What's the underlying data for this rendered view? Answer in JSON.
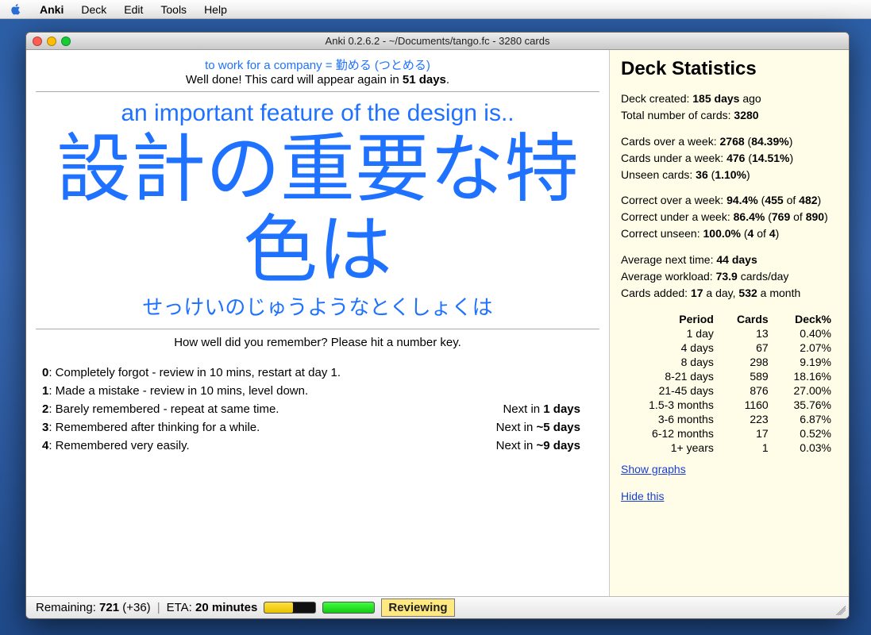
{
  "menubar": {
    "app": "Anki",
    "items": [
      "Deck",
      "Edit",
      "Tools",
      "Help"
    ]
  },
  "window": {
    "title": "Anki 0.2.6.2 - ~/Documents/tango.fc - 3280 cards"
  },
  "feedback": {
    "prev": "to work for a company = 勤める (つとめる)",
    "msg_prefix": "Well done! This card will appear again in ",
    "msg_days": "51 days",
    "msg_suffix": "."
  },
  "card": {
    "hint": "an important feature of the design is..",
    "main": "設計の重要な特色は",
    "reading": "せっけいのじゅうようなとくしょくは"
  },
  "answer": {
    "prompt": "How well did you remember? Please hit a number key.",
    "options": [
      {
        "key": "0",
        "text": ": Completely forgot - review in 10 mins, restart at day 1.",
        "next": ""
      },
      {
        "key": "1",
        "text": ": Made a mistake - review in 10 mins, level down.",
        "next": ""
      },
      {
        "key": "2",
        "text": ": Barely remembered - repeat at same time.",
        "next": "Next in 1 days"
      },
      {
        "key": "3",
        "text": ": Remembered after thinking for a while.",
        "next": "Next in ~5 days"
      },
      {
        "key": "4",
        "text": ": Remembered very easily.",
        "next": "Next in ~9 days"
      }
    ]
  },
  "stats": {
    "title": "Deck Statistics",
    "created_label": "Deck created: ",
    "created_value": "185 days",
    "created_suffix": " ago",
    "total_label": "Total number of cards: ",
    "total_value": "3280",
    "over_week": "Cards over a week: 2768 (84.39%)",
    "under_week": "Cards under a week: 476 (14.51%)",
    "unseen": "Unseen cards: 36 (1.10%)",
    "correct_over": "Correct over a week: 94.4% (455 of 482)",
    "correct_under": "Correct under a week: 86.4% (769 of 890)",
    "correct_unseen": "Correct unseen: 100.0% (4 of 4)",
    "avg_next": "Average next time: 44 days",
    "avg_work": "Average workload: 73.9 cards/day",
    "added": "Cards added: 17 a day, 532 a month",
    "table_headers": [
      "Period",
      "Cards",
      "Deck%"
    ],
    "table_rows": [
      [
        "1 day",
        "13",
        "0.40%"
      ],
      [
        "4 days",
        "67",
        "2.07%"
      ],
      [
        "8 days",
        "298",
        "9.19%"
      ],
      [
        "8-21 days",
        "589",
        "18.16%"
      ],
      [
        "21-45 days",
        "876",
        "27.00%"
      ],
      [
        "1.5-3 months",
        "1160",
        "35.76%"
      ],
      [
        "3-6 months",
        "223",
        "6.87%"
      ],
      [
        "6-12 months",
        "17",
        "0.52%"
      ],
      [
        "1+ years",
        "1",
        "0.03%"
      ]
    ],
    "show_graphs": "Show graphs",
    "hide_this": "Hide this"
  },
  "status": {
    "remaining_label": "Remaining: ",
    "remaining_value": "721",
    "remaining_extra": " (+36)",
    "eta_label": "ETA: ",
    "eta_value": "20 minutes",
    "yellow_pct": 55,
    "green_pct": 100,
    "mode": "Reviewing"
  }
}
